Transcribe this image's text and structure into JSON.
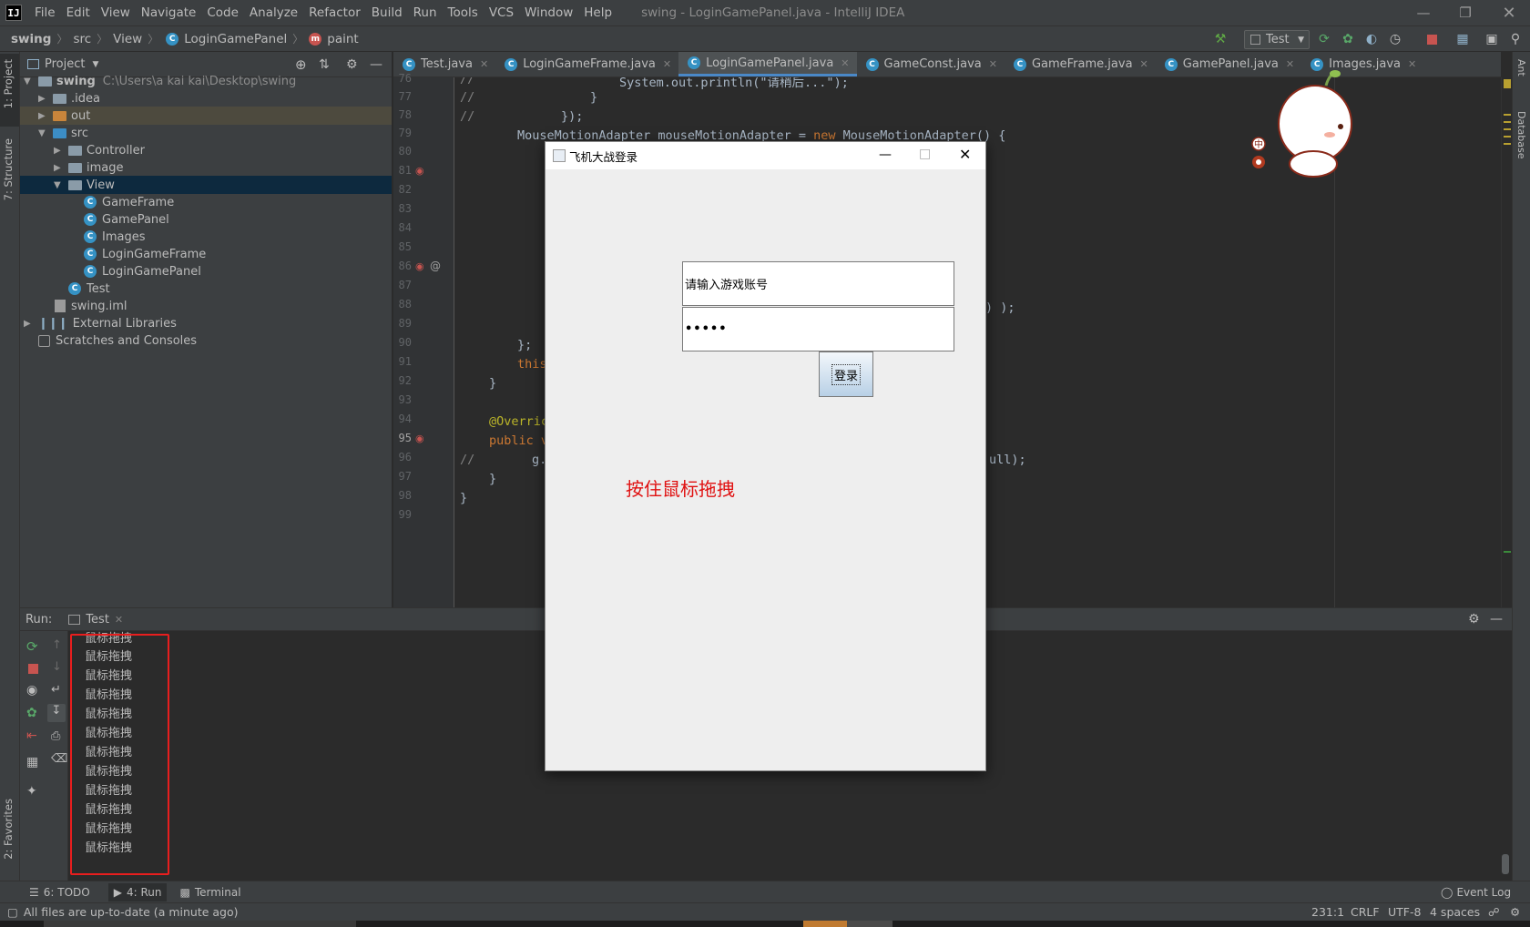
{
  "app": {
    "title": "swing - LoginGamePanel.java - IntelliJ IDEA",
    "logo": "IJ",
    "menu": [
      "File",
      "Edit",
      "View",
      "Navigate",
      "Code",
      "Analyze",
      "Refactor",
      "Build",
      "Run",
      "Tools",
      "VCS",
      "Window",
      "Help"
    ]
  },
  "breadcrumb": [
    "swing",
    "src",
    "View",
    "LoginGamePanel",
    "paint"
  ],
  "run_config": "Test",
  "left_stripe": {
    "project_tab": "1: Project",
    "structure_tab": "7: Structure",
    "favorites_tab": "2: Favorites"
  },
  "right_stripe": {
    "ant_tab": "Ant",
    "database_tab": "Database"
  },
  "project": {
    "header": "Project",
    "root": {
      "name": "swing",
      "path": "C:\\Users\\a kai kai\\Desktop\\swing"
    },
    "items": [
      {
        "label": ".idea"
      },
      {
        "label": "out"
      },
      {
        "label": "src"
      },
      {
        "label": "Controller"
      },
      {
        "label": "image"
      },
      {
        "label": "View"
      },
      {
        "label": "GameFrame"
      },
      {
        "label": "GamePanel"
      },
      {
        "label": "Images"
      },
      {
        "label": "LoginGameFrame"
      },
      {
        "label": "LoginGamePanel"
      },
      {
        "label": "Test"
      },
      {
        "label": "swing.iml"
      },
      {
        "label": "External Libraries"
      },
      {
        "label": "Scratches and Consoles"
      }
    ]
  },
  "editor": {
    "tabs": [
      "Test.java",
      "LoginGameFrame.java",
      "LoginGamePanel.java",
      "GameConst.java",
      "GameFrame.java",
      "GamePanel.java",
      "Images.java"
    ],
    "active_tab": "LoginGamePanel.java",
    "line_numbers": [
      "76",
      "77",
      "78",
      "79",
      "80",
      "81",
      "82",
      "83",
      "84",
      "85",
      "86",
      "87",
      "88",
      "89",
      "90",
      "91",
      "92",
      "93",
      "94",
      "95",
      "96",
      "97",
      "98",
      "99"
    ],
    "current_line": "95",
    "code": {
      "l76a": "//",
      "l76b": "System.out.println(\"请稍后...\");",
      "l77a": "//",
      "l77b": "}",
      "l78a": "//",
      "l78b": "});",
      "l79a": "MouseMotionAdapter mouseMotionAdapter = ",
      "l79b": "new",
      "l79c": " MouseMotionAdapter() {",
      "l88": ") );",
      "l90": "};",
      "l91": "this",
      "l92": "}",
      "l94": "@Overric",
      "l95a": "public",
      "l95b": " v",
      "l96a": "//",
      "l96b": "g.",
      "l96c": "ull);",
      "l97": "}",
      "l98": "}"
    }
  },
  "run": {
    "label": "Run:",
    "tab": "Test",
    "output": [
      "鼠标拖拽",
      "鼠标拖拽",
      "鼠标拖拽",
      "鼠标拖拽",
      "鼠标拖拽",
      "鼠标拖拽",
      "鼠标拖拽",
      "鼠标拖拽",
      "鼠标拖拽",
      "鼠标拖拽",
      "鼠标拖拽",
      "鼠标拖拽"
    ]
  },
  "bottom_tabs": {
    "todo": "6: TODO",
    "run": "4: Run",
    "terminal": "Terminal",
    "event_log": "Event Log"
  },
  "status": {
    "message": "All files are up-to-date (a minute ago)",
    "position": "231:1",
    "line_sep": "CRLF",
    "encoding": "UTF-8",
    "indent": "4 spaces"
  },
  "dialog": {
    "title": "飞机大战登录",
    "account_value": "请输入游戏账号",
    "password_value": "•••••",
    "login_label": "登录",
    "hint_text": "按住鼠标拖拽",
    "hint_color": "#e01010"
  },
  "mascot": {
    "ime_label": "中"
  },
  "colors": {
    "accent": "#4a88c7",
    "highlight_box": "#e81e1e",
    "class_icon": "#3592c4"
  }
}
